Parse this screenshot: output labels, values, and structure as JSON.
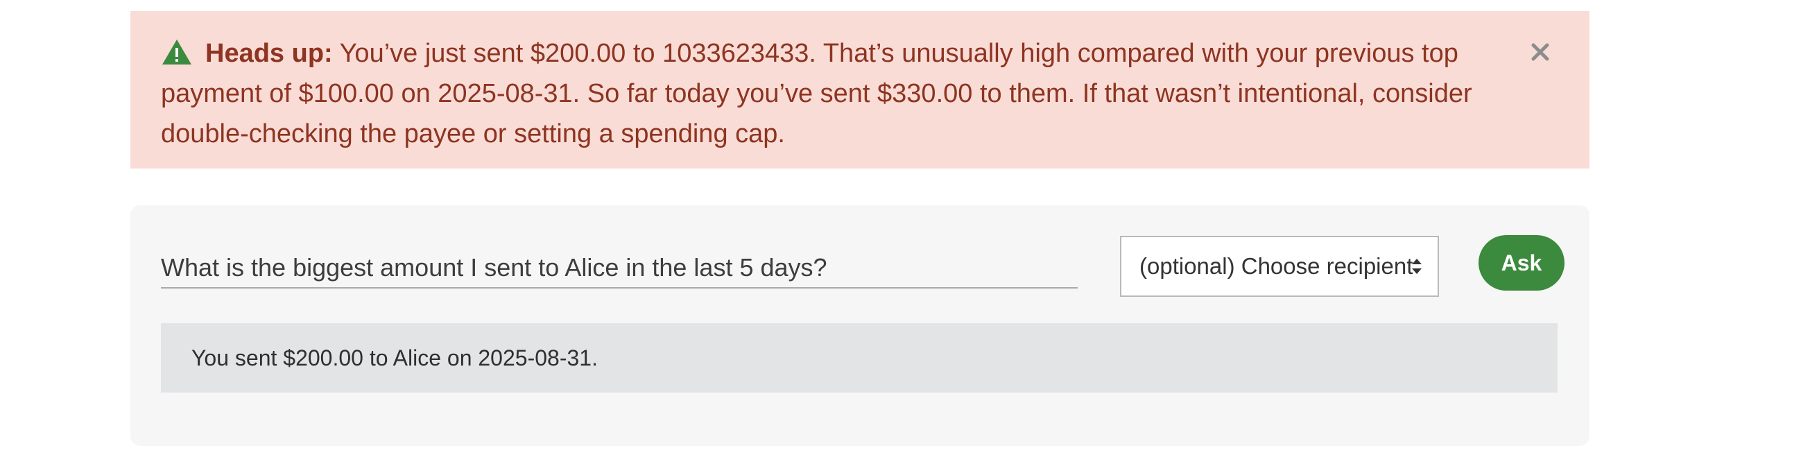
{
  "alert": {
    "icon": "warning-triangle-icon",
    "heading": "Heads up:",
    "message": "You’ve just sent $200.00 to 1033623433. That’s unusually high compared with your previous top payment of $100.00 on 2025-08-31. So far today you’ve sent $330.00 to them. If that wasn’t intentional, consider double-checking the payee or setting a spending cap.",
    "close_icon": "close-icon",
    "colors": {
      "background": "#f9dcd6",
      "text": "#8e3421",
      "icon": "#3b8a3d"
    }
  },
  "query": {
    "question_value": "What is the biggest amount I sent to Alice in the last 5 days?",
    "recipient_select": {
      "selected": "(optional) Choose recipient",
      "icon": "select-arrows-icon"
    },
    "ask_label": "Ask",
    "answer": "You sent $200.00 to Alice on 2025-08-31.",
    "colors": {
      "button": "#3b8a3d",
      "answer_background": "#e3e4e5"
    }
  }
}
